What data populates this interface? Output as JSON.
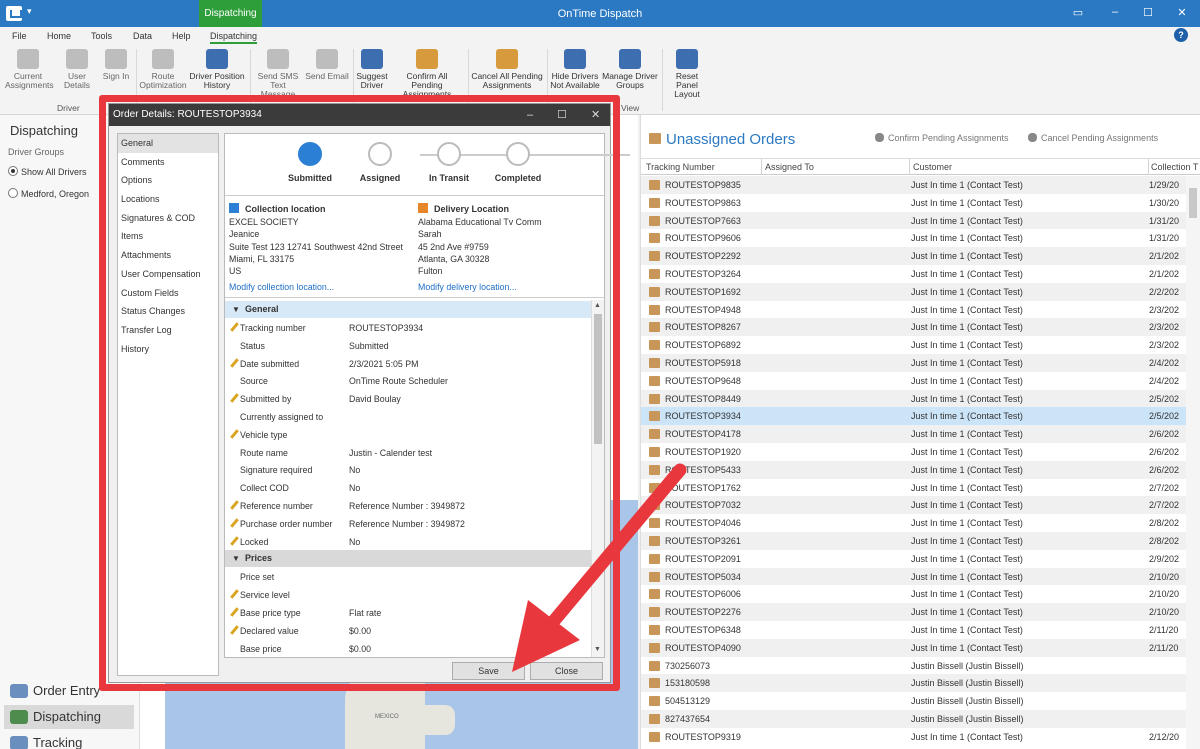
{
  "app": {
    "title": "OnTime Dispatch",
    "context_tab": "Dispatching",
    "menu": [
      "File",
      "Home",
      "Tools",
      "Data",
      "Help",
      "Dispatching"
    ],
    "help": "?"
  },
  "ribbon": {
    "buttons": [
      {
        "l1": "Current",
        "l2": "Assignments"
      },
      {
        "l1": "User Details",
        "l2": ""
      },
      {
        "l1": "Sign In",
        "l2": ""
      },
      {
        "l1": "Route",
        "l2": "Optimization"
      },
      {
        "l1": "Driver Position",
        "l2": "History"
      },
      {
        "l1": "Send SMS",
        "l2": "Text Message"
      },
      {
        "l1": "Send Email",
        "l2": ""
      },
      {
        "l1": "Suggest",
        "l2": "Driver"
      },
      {
        "l1": "Confirm All Pending",
        "l2": "Assignments"
      },
      {
        "l1": "Cancel All Pending",
        "l2": "Assignments"
      },
      {
        "l1": "Hide Drivers",
        "l2": "Not Available"
      },
      {
        "l1": "Manage Driver",
        "l2": "Groups"
      },
      {
        "l1": "Reset Panel",
        "l2": "Layout"
      }
    ],
    "group_driver": "Driver",
    "group_view": "View"
  },
  "left": {
    "title": "Dispatching",
    "groups_label": "Driver Groups",
    "options": [
      "Show All Drivers",
      "Medford, Oregon"
    ],
    "nav": [
      "Order Entry",
      "Dispatching",
      "Tracking"
    ]
  },
  "map": {
    "label": "MEXICO"
  },
  "unassigned": {
    "title": "Unassigned Orders",
    "confirm": "Confirm Pending Assignments",
    "cancel": "Cancel Pending Assignments",
    "columns": [
      "Tracking Number",
      "Assigned To",
      "Customer",
      "Collection T"
    ],
    "rows": [
      [
        "ROUTESTOP9835",
        "",
        "Just In time 1 (Contact Test)",
        "1/29/20"
      ],
      [
        "ROUTESTOP9863",
        "",
        "Just In time 1 (Contact Test)",
        "1/30/20"
      ],
      [
        "ROUTESTOP7663",
        "",
        "Just In time 1 (Contact Test)",
        "1/31/20"
      ],
      [
        "ROUTESTOP9606",
        "",
        "Just In time 1 (Contact Test)",
        "1/31/20"
      ],
      [
        "ROUTESTOP2292",
        "",
        "Just In time 1 (Contact Test)",
        "2/1/202"
      ],
      [
        "ROUTESTOP3264",
        "",
        "Just In time 1 (Contact Test)",
        "2/1/202"
      ],
      [
        "ROUTESTOP1692",
        "",
        "Just In time 1 (Contact Test)",
        "2/2/202"
      ],
      [
        "ROUTESTOP4948",
        "",
        "Just In time 1 (Contact Test)",
        "2/3/202"
      ],
      [
        "ROUTESTOP8267",
        "",
        "Just In time 1 (Contact Test)",
        "2/3/202"
      ],
      [
        "ROUTESTOP6892",
        "",
        "Just In time 1 (Contact Test)",
        "2/3/202"
      ],
      [
        "ROUTESTOP5918",
        "",
        "Just In time 1 (Contact Test)",
        "2/4/202"
      ],
      [
        "ROUTESTOP9648",
        "",
        "Just In time 1 (Contact Test)",
        "2/4/202"
      ],
      [
        "ROUTESTOP8449",
        "",
        "Just In time 1 (Contact Test)",
        "2/5/202"
      ],
      [
        "ROUTESTOP3934",
        "",
        "Just In time 1 (Contact Test)",
        "2/5/202"
      ],
      [
        "ROUTESTOP4178",
        "",
        "Just In time 1 (Contact Test)",
        "2/6/202"
      ],
      [
        "ROUTESTOP1920",
        "",
        "Just In time 1 (Contact Test)",
        "2/6/202"
      ],
      [
        "ROUTESTOP5433",
        "",
        "Just In time 1 (Contact Test)",
        "2/6/202"
      ],
      [
        "ROUTESTOP1762",
        "",
        "Just In time 1 (Contact Test)",
        "2/7/202"
      ],
      [
        "ROUTESTOP7032",
        "",
        "Just In time 1 (Contact Test)",
        "2/7/202"
      ],
      [
        "ROUTESTOP4046",
        "",
        "Just In time 1 (Contact Test)",
        "2/8/202"
      ],
      [
        "ROUTESTOP3261",
        "",
        "Just In time 1 (Contact Test)",
        "2/8/202"
      ],
      [
        "ROUTESTOP2091",
        "",
        "Just In time 1 (Contact Test)",
        "2/9/202"
      ],
      [
        "ROUTESTOP5034",
        "",
        "Just In time 1 (Contact Test)",
        "2/10/20"
      ],
      [
        "ROUTESTOP6006",
        "",
        "Just In time 1 (Contact Test)",
        "2/10/20"
      ],
      [
        "ROUTESTOP2276",
        "",
        "Just In time 1 (Contact Test)",
        "2/10/20"
      ],
      [
        "ROUTESTOP6348",
        "",
        "Just In time 1 (Contact Test)",
        "2/11/20"
      ],
      [
        "ROUTESTOP4090",
        "",
        "Just In time 1 (Contact Test)",
        "2/11/20"
      ],
      [
        "730256073",
        "",
        "Justin Bissell (Justin Bissell)",
        ""
      ],
      [
        "153180598",
        "",
        "Justin Bissell (Justin Bissell)",
        ""
      ],
      [
        "504513129",
        "",
        "Justin Bissell (Justin Bissell)",
        ""
      ],
      [
        "827437654",
        "",
        "Justin Bissell (Justin Bissell)",
        ""
      ],
      [
        "ROUTESTOP9319",
        "",
        "Just In time 1 (Contact Test)",
        "2/12/20"
      ]
    ]
  },
  "dialog": {
    "title": "Order Details: ROUTESTOP3934",
    "nav": [
      "General",
      "Comments",
      "Options",
      "Locations",
      "Signatures & COD",
      "Items",
      "Attachments",
      "User Compensation",
      "Custom Fields",
      "Status Changes",
      "Transfer Log",
      "History"
    ],
    "steps": [
      "Submitted",
      "Assigned",
      "In Transit",
      "Completed"
    ],
    "collection": {
      "heading": "Collection location",
      "lines": [
        "EXCEL SOCIETY",
        "Jeanice",
        "Suite Test 123 12741 Southwest 42nd Street",
        "Miami, FL  33175",
        "US"
      ],
      "link": "Modify collection location..."
    },
    "delivery": {
      "heading": "Delivery Location",
      "lines": [
        "Alabama Educational Tv Comm",
        "Sarah",
        "45 2nd Ave #9759",
        "Atlanta, GA  30328",
        "Fulton"
      ],
      "link": "Modify delivery location..."
    },
    "sections": [
      {
        "name": "General",
        "style": "blue",
        "rows": [
          {
            "k": "Tracking number",
            "v": "ROUTESTOP3934",
            "edit": true
          },
          {
            "k": "Status",
            "v": "Submitted",
            "edit": false
          },
          {
            "k": "Date submitted",
            "v": "2/3/2021 5:05 PM",
            "edit": true
          },
          {
            "k": "Source",
            "v": "OnTime Route Scheduler",
            "edit": false
          },
          {
            "k": "Submitted by",
            "v": "David Boulay",
            "edit": true
          },
          {
            "k": "Currently assigned to",
            "v": "",
            "edit": false
          },
          {
            "k": "Vehicle type",
            "v": "",
            "edit": true
          },
          {
            "k": "Route name",
            "v": "Justin - Calender test",
            "edit": false
          },
          {
            "k": "Signature required",
            "v": "No",
            "edit": false
          },
          {
            "k": "Collect COD",
            "v": "No",
            "edit": false
          },
          {
            "k": "Reference number",
            "v": "Reference Number : 3949872",
            "edit": true
          },
          {
            "k": "Purchase order number",
            "v": "Reference Number : 3949872",
            "edit": true
          },
          {
            "k": "Locked",
            "v": "No",
            "edit": true
          }
        ]
      },
      {
        "name": "Prices",
        "style": "gray",
        "rows": [
          {
            "k": "Price set",
            "v": "",
            "edit": false
          },
          {
            "k": "Service level",
            "v": "",
            "edit": true
          },
          {
            "k": "Base price type",
            "v": "Flat rate",
            "edit": true
          },
          {
            "k": "Declared value",
            "v": "$0.00",
            "edit": true
          },
          {
            "k": "Base price",
            "v": "$0.00",
            "edit": false
          }
        ]
      }
    ],
    "save": "Save",
    "close": "Close"
  },
  "colors": {
    "titlebar": "#2b79c2",
    "context": "#2e9e3a",
    "highlight": "#e8383e",
    "selected_row": "#cce4f7"
  }
}
